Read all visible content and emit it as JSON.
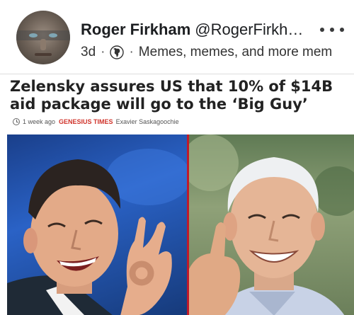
{
  "post": {
    "author_name": "Roger Firkham",
    "author_handle": "@RogerFirkh…",
    "time": "3d",
    "group": "Memes, memes, and more mem"
  },
  "article": {
    "headline": "Zelensky assures US that 10% of $14B aid package will go to the ‘Big Guy’",
    "time_ago": "1 week ago",
    "source": "GENESIUS TIMES",
    "author": "Exavier Saskagoochie"
  },
  "icons": {
    "more": "more-horizontal-icon",
    "audience": "globe-icon",
    "time": "clock-icon"
  },
  "colors": {
    "source_red": "#d0342c",
    "divider_red": "#c01a2a"
  }
}
